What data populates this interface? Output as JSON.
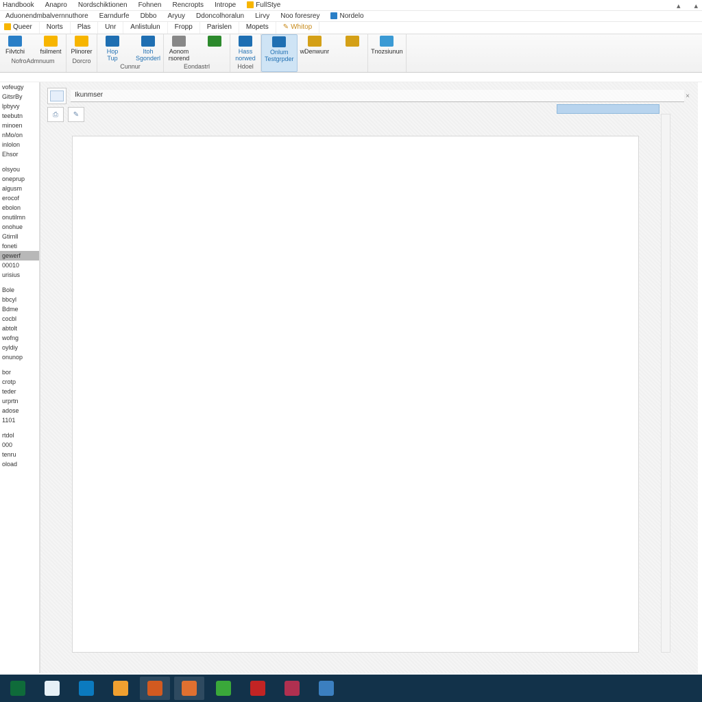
{
  "menu1": [
    "Handbook",
    "Anapro",
    "Nordschiktionen",
    "Fohnen",
    "Rencropts",
    "Intrope",
    "FullStye"
  ],
  "menu2": [
    "Aduonendmbalvernnuthore",
    "Earndurfe",
    "Dbbo",
    "Aryuy",
    "Ddoncolhoralun",
    "Lirvy",
    "Noo foresrey",
    "Nordelo"
  ],
  "tabs": [
    "Queer",
    "Norts",
    "Plas",
    "Unr",
    "Anlistulun",
    "Fropp",
    "Parislen",
    "Mopets",
    "Whitop"
  ],
  "ribbon": {
    "g1": {
      "btns": [
        {
          "l": "Filvtchi",
          "c": "#2a7fc7"
        },
        {
          "l": "fsilment",
          "c": "#f7b500"
        }
      ],
      "label": "NofroAdmnuum"
    },
    "g2": {
      "btns": [
        {
          "l": "Plinorer",
          "c": "#f7b500"
        }
      ],
      "label": "Dorcro"
    },
    "g3": {
      "btns": [
        {
          "l": "Hop\nTup",
          "c": "#1f6fb2"
        },
        {
          "l": "Itoh\nSgonderl",
          "c": "#1f6fb2"
        }
      ],
      "label": "Cunnur"
    },
    "g4": {
      "btns": [
        {
          "l": "Aonom\nrsorend",
          "c": "#888"
        },
        {
          "l": "",
          "c": "#2d8a2d"
        }
      ],
      "label": "Eondastrl"
    },
    "g5": {
      "btns": [
        {
          "l": "Hass\nnorwed",
          "c": "#1f6fb2"
        }
      ],
      "label": "Hdoel"
    },
    "g6": {
      "btns": [
        {
          "l": "Onlum\nTestgrpder",
          "c": "#1f6fb2"
        }
      ],
      "label": ""
    },
    "g7": {
      "btns": [
        {
          "l": "wDenwunr",
          "c": "#d4a017"
        },
        {
          "l": "",
          "c": "#d4a017"
        }
      ],
      "label": ""
    },
    "g8": {
      "btns": [
        {
          "l": "Tnozsiunun",
          "c": "#3b9ad4"
        }
      ],
      "label": ""
    }
  },
  "subrow": "",
  "nav": [
    "vofeugy",
    "GitsrBy",
    "lpbyvy",
    "teebutn",
    "minoen",
    "nMo/on",
    "inlolon",
    "Ehsor",
    "",
    "olsyou",
    "oneprup",
    "algusm",
    "erocof",
    "ebolon",
    "onutilmn",
    "onohue",
    "Gtirnll",
    "foneti",
    "gewerf",
    "00010",
    "urisius",
    "",
    "Bole",
    "bbcyl",
    "Bdme",
    "cocbl",
    "abtolt",
    "wofng",
    "oyldiy",
    "onunop",
    "",
    "bor",
    "crotp",
    "teder",
    "urprtn",
    "adose",
    "1101",
    "",
    "rtdol",
    "000",
    "tenru",
    "oload"
  ],
  "navsel": 18,
  "doc": {
    "title": "Ikunmser",
    "tab": ""
  },
  "taskbar": [
    "#0f6b3a",
    "#e6f0f6",
    "#0b7abf",
    "#f0a030",
    "#d25a20",
    "#e07030",
    "#3aa83a",
    "#c22424",
    "#b03050",
    "#3b7fc0"
  ],
  "taskbar_active": [
    4,
    5
  ]
}
